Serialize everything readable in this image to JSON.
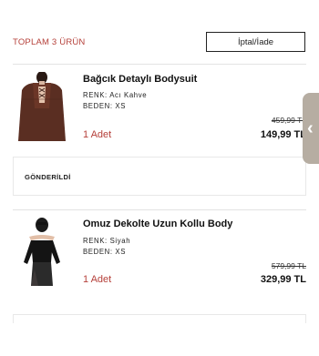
{
  "header": {
    "total_label": "TOPLAM 3 ÜRÜN",
    "cancel_return_label": "İptal/İade"
  },
  "products": [
    {
      "name": "Bağcık Detaylı Bodysuit",
      "color_label": "RENK:",
      "color_value": "Acı Kahve",
      "size_label": "BEDEN:",
      "size_value": "XS",
      "quantity": "1 Adet",
      "old_price": "459,99 TL",
      "new_price": "149,99 TL"
    },
    {
      "name": "Omuz Dekolte Uzun Kollu Body",
      "color_label": "RENK:",
      "color_value": "Siyah",
      "size_label": "BEDEN:",
      "size_value": "XS",
      "quantity": "1 Adet",
      "old_price": "579,99 TL",
      "new_price": "329,99 TL"
    }
  ],
  "status": {
    "label": "GÖNDERİLDİ"
  },
  "side_handle": {
    "icon": "chevron-left-icon"
  },
  "colors": {
    "accent": "#b5403a",
    "handle": "#b6ada2"
  }
}
